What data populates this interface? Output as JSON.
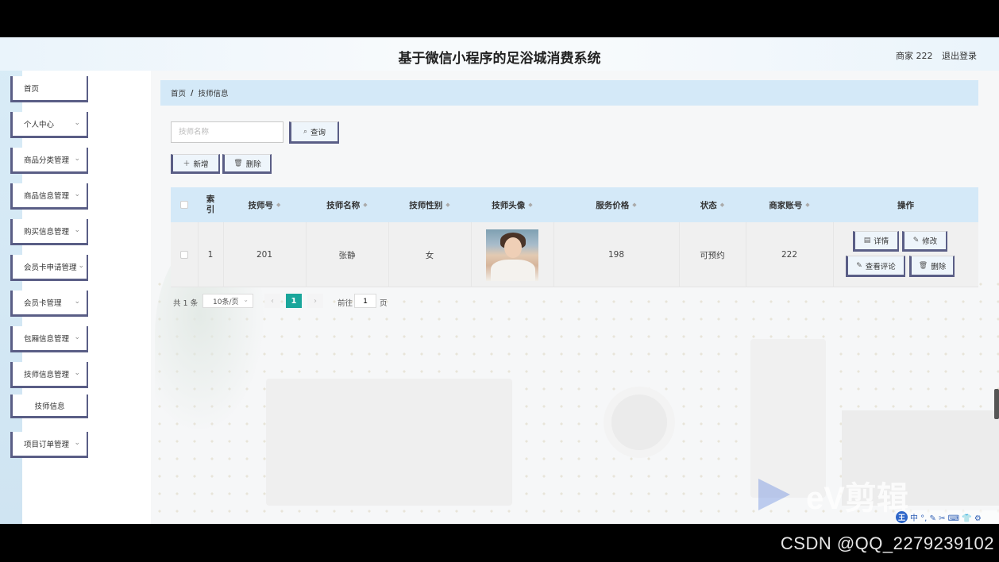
{
  "app": {
    "title": "基于微信小程序的足浴城消费系统",
    "merchant_label": "商家 222",
    "logout_label": "退出登录"
  },
  "sidebar": {
    "items": [
      {
        "label": "首页",
        "has_arrow": false
      },
      {
        "label": "个人中心",
        "has_arrow": true
      },
      {
        "label": "商品分类管理",
        "has_arrow": true
      },
      {
        "label": "商品信息管理",
        "has_arrow": true
      },
      {
        "label": "购买信息管理",
        "has_arrow": true
      },
      {
        "label": "会员卡申请管理",
        "has_arrow": true
      },
      {
        "label": "会员卡管理",
        "has_arrow": true
      },
      {
        "label": "包厢信息管理",
        "has_arrow": true
      },
      {
        "label": "技师信息管理",
        "has_arrow": true
      },
      {
        "label": "项目订单管理",
        "has_arrow": true
      }
    ],
    "submenu": {
      "label": "技师信息"
    }
  },
  "breadcrumb": {
    "home": "首页",
    "separator": "/",
    "current": "技师信息"
  },
  "search": {
    "placeholder": "技师名称",
    "value": "",
    "button_label": "查询"
  },
  "toolbar": {
    "add_label": "新增",
    "delete_label": "删除"
  },
  "table": {
    "headers": [
      "索引",
      "技师号",
      "技师名称",
      "技师性别",
      "技师头像",
      "服务价格",
      "状态",
      "商家账号",
      "操作"
    ],
    "header_index_lines": [
      "索",
      "引"
    ],
    "rows": [
      {
        "index": "1",
        "tech_no": "201",
        "name": "张静",
        "gender": "女",
        "price": "198",
        "status": "可预约",
        "merchant_account": "222",
        "actions": {
          "detail": "详情",
          "edit": "修改",
          "comments": "查看评论",
          "delete": "删除"
        }
      }
    ]
  },
  "pagination": {
    "total_text": "共 1 条",
    "page_size": "10条/页",
    "current_page": "1",
    "goto_label": "前往",
    "goto_value": "1",
    "page_unit": "页"
  },
  "overlays": {
    "watermark": "CSDN @QQ_2279239102",
    "ev_logo": "eV剪辑",
    "ime_logo": "王",
    "ime_text": "中 °, ✎ ✂ ⌨ 👕 ⚙"
  },
  "colors": {
    "accent": "#1aa69b",
    "header_bg": "#d4e9f8",
    "menu_border": "#5a5e86"
  }
}
